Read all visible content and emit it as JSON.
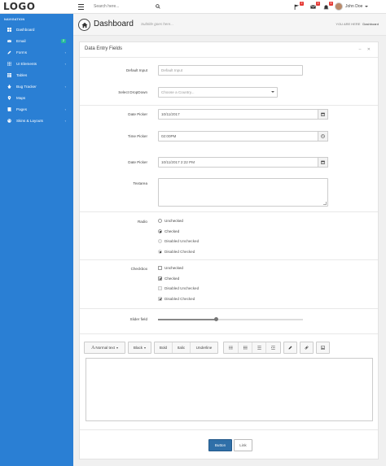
{
  "topbar": {
    "logo": "LOGO",
    "search_placeholder": "Search here...",
    "notifications": [
      {
        "name": "flag-icon",
        "count": "2"
      },
      {
        "name": "mail-icon",
        "count": "3"
      },
      {
        "name": "bell-icon",
        "count": "5"
      }
    ],
    "user_name": "John Doe"
  },
  "sidebar": {
    "title": "NAVIGATION",
    "items": [
      {
        "label": "Dashboard",
        "icon": "dashboard-icon",
        "badge": "",
        "chevron": ""
      },
      {
        "label": "Email",
        "icon": "mail-icon",
        "badge": "2",
        "chevron": ""
      },
      {
        "label": "Forms",
        "icon": "edit-icon",
        "badge": "",
        "chevron": "‹"
      },
      {
        "label": "UI Elements",
        "icon": "grid-icon",
        "badge": "",
        "chevron": "‹"
      },
      {
        "label": "Tables",
        "icon": "table-icon",
        "badge": "",
        "chevron": ""
      },
      {
        "label": "Bug Tracker",
        "icon": "bug-icon",
        "badge": "",
        "chevron": "‹"
      },
      {
        "label": "Maps",
        "icon": "map-icon",
        "badge": "",
        "chevron": ""
      },
      {
        "label": "Pages",
        "icon": "pages-icon",
        "badge": "",
        "chevron": "‹"
      },
      {
        "label": "Skins & Layouts",
        "icon": "palette-icon",
        "badge": "",
        "chevron": "‹"
      }
    ]
  },
  "header": {
    "title": "Dashboard",
    "subtitle": "Subtitle goes here...",
    "breadcrumb_prefix": "YOU ARE HERE",
    "breadcrumb_current": "Dashboard"
  },
  "panel": {
    "title": "Data Entry Fields",
    "tools": "– ✕",
    "default_input": {
      "label": "Default Input",
      "placeholder": "Default Input"
    },
    "select": {
      "label": "Select DropDown",
      "value": "Choose a Country..."
    },
    "date_picker": {
      "label": "Date Picker",
      "value": "10/11/2017"
    },
    "time_picker": {
      "label": "Time Picker",
      "value": "02:00PM"
    },
    "datetime_picker": {
      "label": "Date Picker",
      "value": "10/11/2017 2:22 PM"
    },
    "textarea": {
      "label": "Textarea"
    },
    "radio": {
      "label": "Radio",
      "options": [
        "Unchecked",
        "Checked",
        "Disabled Unchecked",
        "Disabled Checked"
      ]
    },
    "checkbox": {
      "label": "Checkbox",
      "options": [
        "Unchecked",
        "Checked",
        "Disabled Unchecked",
        "Disabled Checked"
      ]
    },
    "slider": {
      "label": "Slider field",
      "value_fraction": 0.4
    },
    "editor_toolbar": {
      "font": "Normal text",
      "color": "Black",
      "bold": "Bold",
      "italic": "Italic",
      "underline": "Underline"
    },
    "buttons": {
      "primary": "Button",
      "link": "Link"
    }
  }
}
